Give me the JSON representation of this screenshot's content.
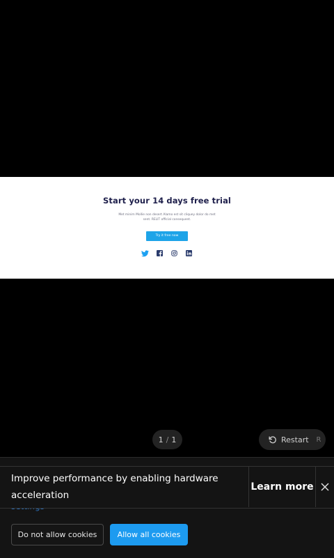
{
  "slide": {
    "title": "Start your 14 days free trial",
    "description": "Met minim Mollie non desert Alamo est sit cliquey dolor do met sent. RELIT official consequent.",
    "cta": "Try it free now",
    "social_icons": [
      "twitter-icon",
      "facebook-icon",
      "instagram-icon",
      "linkedin-icon"
    ]
  },
  "player": {
    "current": "1",
    "separator": "/",
    "total": "1",
    "restart_label": "Restart",
    "restart_key": "R"
  },
  "banner": {
    "message": "Improve performance by enabling hardware acceleration",
    "learn_more": "Learn more"
  },
  "cookies": {
    "settings_link": "settings",
    "deny": "Do not allow cookies",
    "allow": "Allow all cookies"
  },
  "colors": {
    "accent": "#1d9bf0",
    "title": "#1e1f4b"
  }
}
